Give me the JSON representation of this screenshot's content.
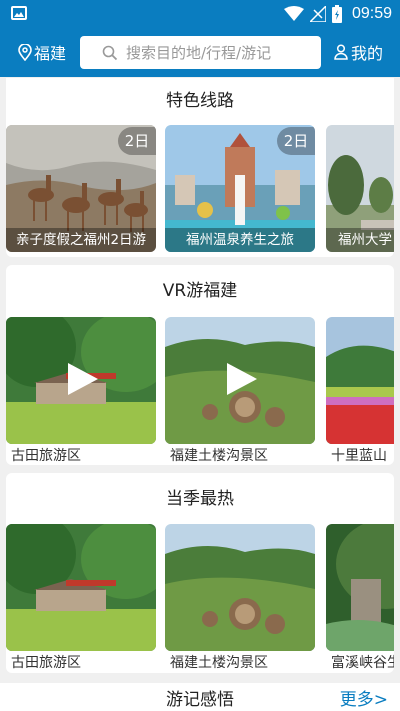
{
  "status_bar": {
    "time": "09:59",
    "icons": [
      "photo-icon",
      "wifi-icon",
      "signal-icon",
      "battery-icon"
    ]
  },
  "header": {
    "location": "福建",
    "search_placeholder": "搜索目的地/行程/游记",
    "mine": "我的",
    "bg_color": "#0a7dc0"
  },
  "sections": {
    "featured": {
      "title": "特色线路",
      "cards": [
        {
          "label": "亲子度假之福州2日游",
          "days": "2日"
        },
        {
          "label": "福州温泉养生之旅",
          "days": "2日"
        },
        {
          "label": "福州大学"
        }
      ]
    },
    "vr": {
      "title": "VR游福建",
      "cards": [
        {
          "label": "古田旅游区"
        },
        {
          "label": "福建土楼沟景区"
        },
        {
          "label": "十里蓝山"
        }
      ]
    },
    "hot": {
      "title": "当季最热",
      "cards": [
        {
          "label": "古田旅游区"
        },
        {
          "label": "福建土楼沟景区"
        },
        {
          "label": "富溪峡谷生"
        }
      ]
    }
  },
  "bottom": {
    "title": "游记感悟",
    "more": "更多>"
  }
}
